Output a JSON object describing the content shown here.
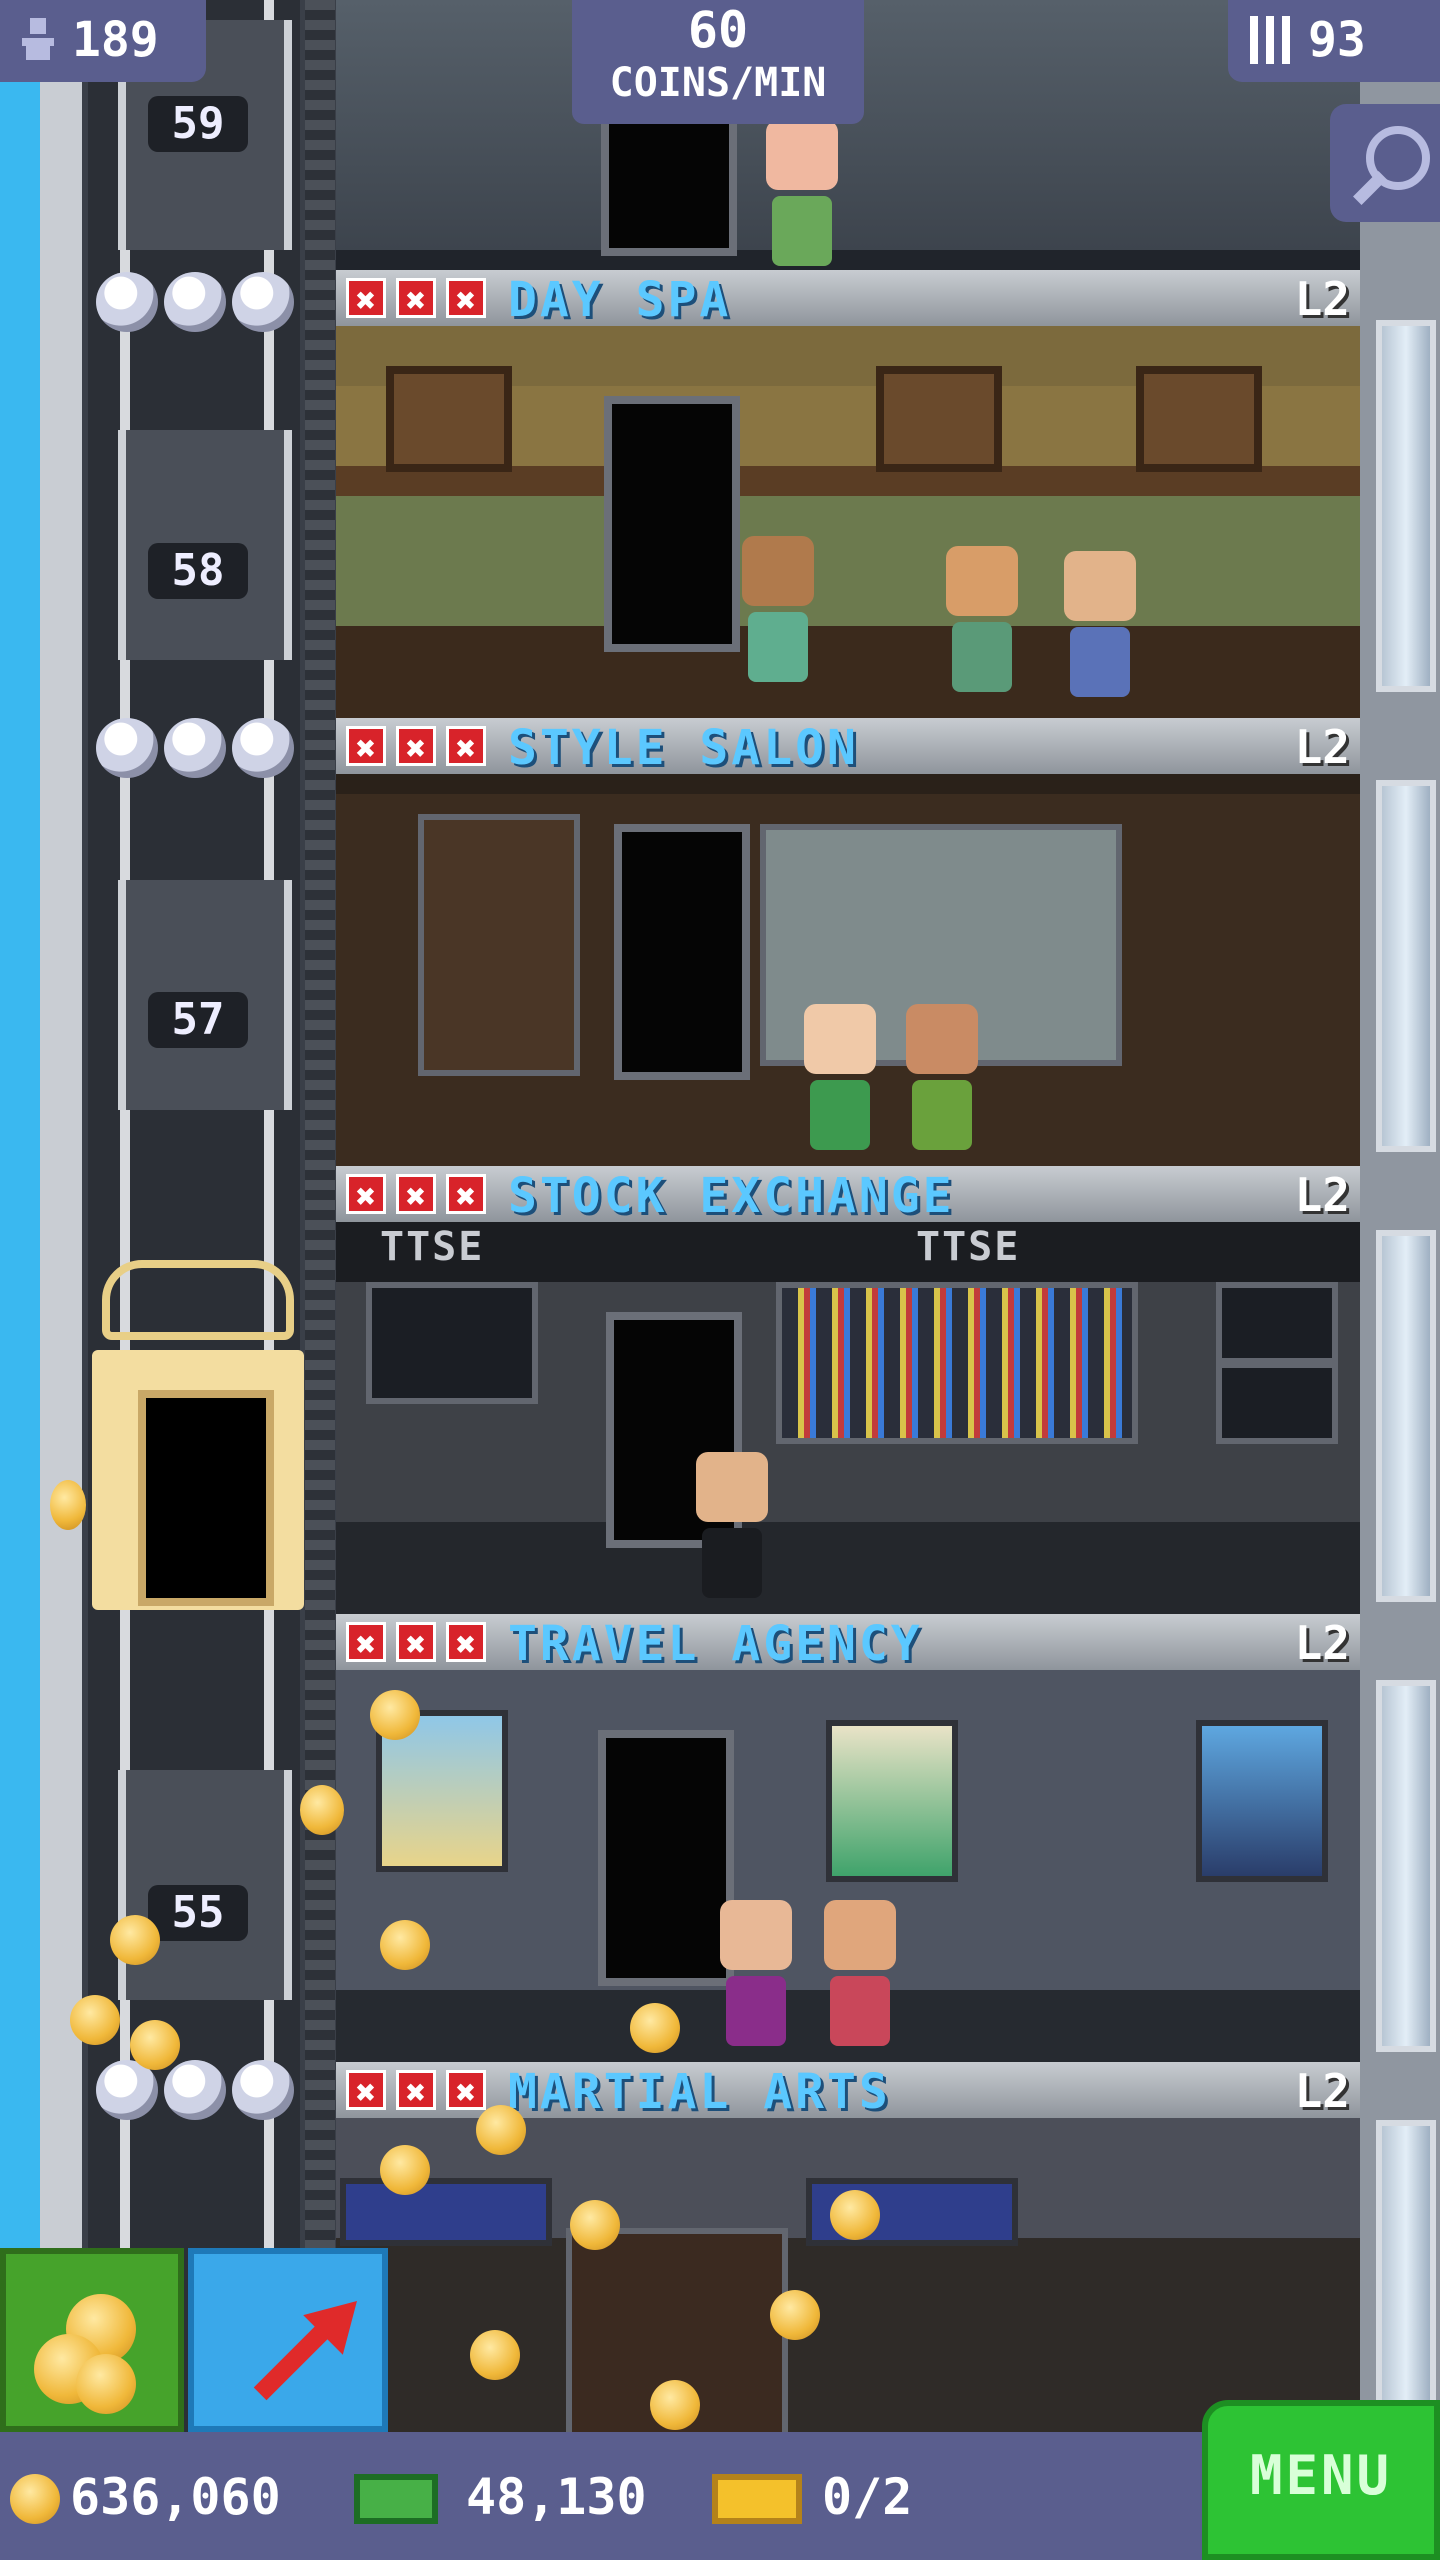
{
  "hud": {
    "population": "189",
    "coins_per_min_value": "60",
    "coins_per_min_label": "COINS/MIN",
    "floors": "93"
  },
  "elevator": {
    "floor_numbers": [
      "59",
      "58",
      "57",
      "55"
    ]
  },
  "rooms": [
    {
      "name": "DAY SPA",
      "level": "L2",
      "x1": "✖",
      "x2": "✖",
      "x3": "✖"
    },
    {
      "name": "STYLE SALON",
      "level": "L2",
      "x1": "✖",
      "x2": "✖",
      "x3": "✖"
    },
    {
      "name": "STOCK EXCHANGE",
      "level": "L2",
      "x1": "✖",
      "x2": "✖",
      "x3": "✖",
      "board1": "TTSE",
      "board2": "TTSE"
    },
    {
      "name": "TRAVEL AGENCY",
      "level": "L2",
      "x1": "✖",
      "x2": "✖",
      "x3": "✖"
    },
    {
      "name": "MARTIAL ARTS",
      "level": "L2",
      "x1": "✖",
      "x2": "✖",
      "x3": "✖"
    }
  ],
  "bottom": {
    "coins": "636,060",
    "bux": "48,130",
    "tickets": "0/2",
    "menu_label": "MENU"
  },
  "colors": {
    "hud_bg": "#5a5e8e",
    "room_title": "#5bc8ff",
    "menu_green": "#2dc334"
  },
  "icons": [
    "population-icon",
    "floors-icon",
    "zoom-icon",
    "coins-icon",
    "raffle-arrow-icon",
    "coin-icon",
    "bux-icon",
    "ticket-icon"
  ]
}
